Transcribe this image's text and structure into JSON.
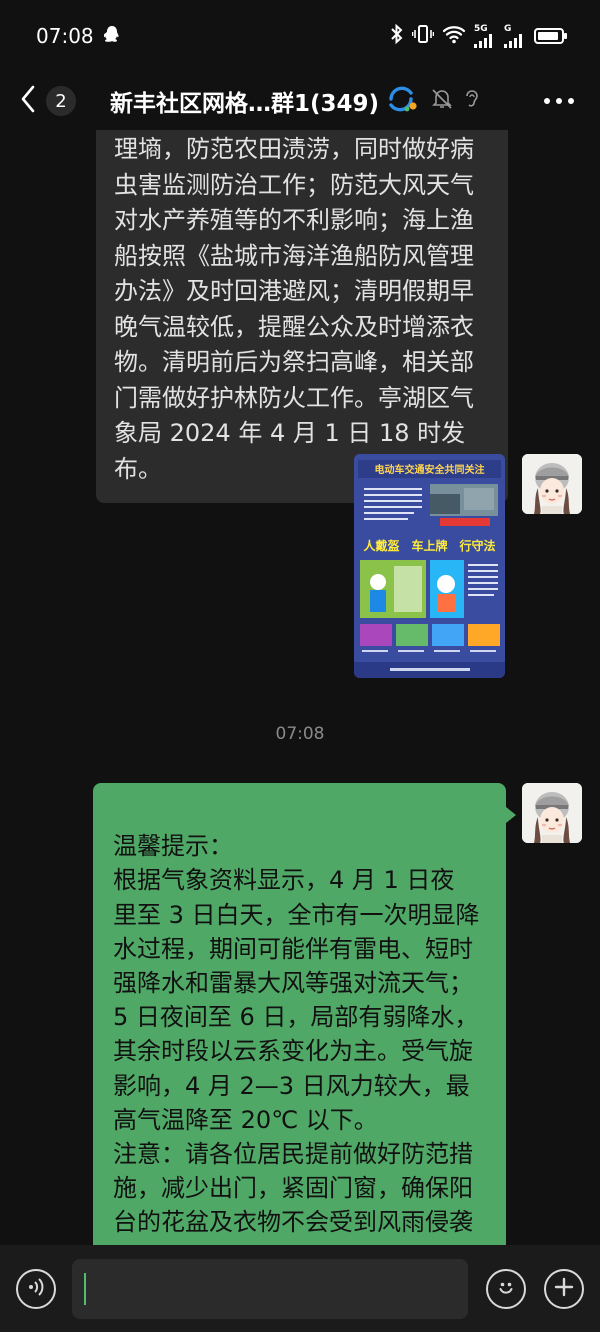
{
  "status_bar": {
    "time": "07:08",
    "network_1": "5G",
    "network_2": "G"
  },
  "nav": {
    "unread_count": "2",
    "title": "新丰社区网格…群1(349)"
  },
  "messages": {
    "msg1_text": "理墒，防范农田渍涝，同时做好病\n虫害监测防治工作；防范大风天气\n对水产养殖等的不利影响；海上渔\n船按照《盐城市海洋渔船防风管理\n办法》及时回港避风；清明假期早\n晚气温较低，提醒公众及时增添衣\n物。清明前后为祭扫高峰，相关部\n门需做好护林防火工作。亭湖区气\n象局 2024 年 4 月 1 日 18 时发布。",
    "image_poster": {
      "headline": "电动车交通安全共同关注",
      "slogan": "人戴盔　车上牌　行守法"
    },
    "timestamp": "07:08",
    "msg2_text": "温馨提示：\n   根据气象资料显示，4 月 1 日夜\n里至 3 日白天，全市有一次明显降\n水过程，期间可能伴有雷电、短时\n强降水和雷暴大风等强对流天气；\n5 日夜间至 6 日，局部有弱降水，\n其余时段以云系变化为主。受气旋\n影响，4 月 2—3 日风力较大，最\n高气温降至 20℃ 以下。\n注意：请各位居民提前做好防范措\n施，减少出门，紧固门窗，确保阳\n台的花盆及衣物不会受到风雨侵袭",
    "msg2_emojis": [
      "🙏",
      "🙏",
      "🙏"
    ]
  },
  "input": {
    "value": "",
    "voice_icon": "voice-icon",
    "emoji_icon": "emoji-icon",
    "plus_icon": "plus-icon"
  },
  "colors": {
    "background": "#111111",
    "gray_bubble": "#2c2c2c",
    "green_bubble": "#4fa866",
    "accent_green": "#4fbf6a"
  }
}
